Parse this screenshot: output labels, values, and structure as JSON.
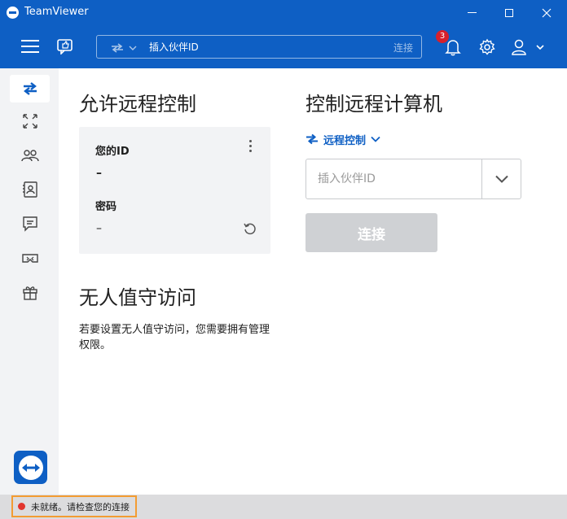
{
  "window": {
    "title": "TeamViewer"
  },
  "toolbar": {
    "partner_placeholder": "插入伙伴ID",
    "connect_label": "连接",
    "notification_count": "3"
  },
  "allow_remote": {
    "heading": "允许远程控制",
    "your_id_label": "您的ID",
    "your_id_value": "–",
    "password_label": "密码",
    "password_value": "–"
  },
  "unattended": {
    "heading": "无人值守访问",
    "description": "若要设置无人值守访问，您需要拥有管理权限。"
  },
  "control_remote": {
    "heading": "控制远程计算机",
    "mode_label": "远程控制",
    "partner_placeholder": "插入伙伴ID",
    "connect_button": "连接"
  },
  "status": {
    "text": "未就绪。请检查您的连接",
    "color": "#e2352d"
  },
  "colors": {
    "brand": "#0e5fc4",
    "accent_border": "#f39c32"
  },
  "sidebar": {
    "items": [
      {
        "icon": "remote-control-icon",
        "active": true
      },
      {
        "icon": "meeting-expand-icon",
        "active": false
      },
      {
        "icon": "contacts-icon",
        "active": false
      },
      {
        "icon": "computers-icon",
        "active": false
      },
      {
        "icon": "chat-icon",
        "active": false
      },
      {
        "icon": "augmented-reality-icon",
        "active": false
      },
      {
        "icon": "gift-icon",
        "active": false
      }
    ]
  }
}
